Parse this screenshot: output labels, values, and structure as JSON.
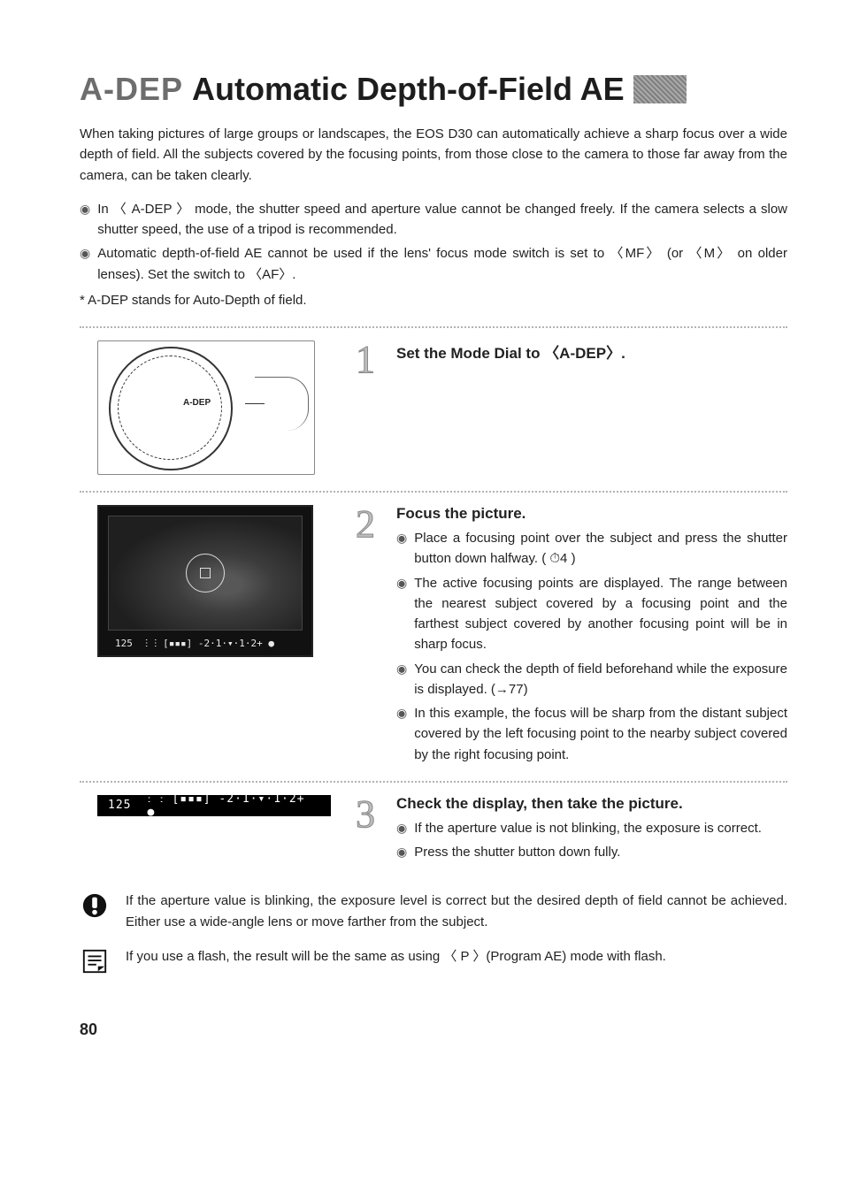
{
  "header": {
    "prefix": "A-DEP",
    "title": "Automatic Depth-of-Field AE"
  },
  "intro_main": "When taking pictures of large groups or landscapes, the EOS D30 can automatically achieve a sharp focus over a wide depth of field. All the subjects covered by the focusing points, from those close to the camera to those far away from the camera, can be taken clearly.",
  "intro_b1": "In 〈 A-DEP 〉 mode, the shutter speed and aperture value cannot be changed freely. If the camera selects a slow shutter speed, the use of a tripod is recommended.",
  "intro_b2": "Automatic depth-of-field AE cannot be used if the lens' focus mode switch is set to 〈MF〉 (or 〈M〉 on older lenses). Set the switch to 〈AF〉.",
  "intro_star": "* A-DEP stands for Auto-Depth of field.",
  "dial_label": "A-DEP",
  "vf_shutter": "125",
  "vf_readout": "ⵗ ⵗ [▪▪▪] -2·1·▾·1·2+ ●",
  "strip_shutter": "125",
  "strip_readout": "ⵗ ⵗ [▪▪▪] -2·1·▾·1·2+ ●",
  "steps": {
    "s1": {
      "num": "1",
      "title": "Set the Mode Dial to 〈A-DEP〉."
    },
    "s2": {
      "num": "2",
      "title": "Focus the picture.",
      "b1": "Place a focusing point over the subject and press the shutter button down halfway. ( ⏱4 )",
      "b2": "The active focusing points are displayed. The range between the nearest subject covered by a focusing point and the farthest subject covered by another focusing point will be in sharp focus.",
      "b3": "You can check the depth of field beforehand while the exposure is displayed. (→77)",
      "b4": "In this example, the focus will be sharp from the distant subject covered by the left focusing point to the nearby subject covered by the right focusing point."
    },
    "s3": {
      "num": "3",
      "title": "Check the display, then take the picture.",
      "b1": "If the aperture value is not blinking, the exposure is correct.",
      "b2": "Press the shutter button down fully."
    }
  },
  "notes": {
    "warn": "If the aperture value is blinking, the exposure level is correct but the desired depth of field cannot be achieved. Either use a wide-angle lens or move farther from the subject.",
    "info": "If you use a flash, the result will be the same as using 〈 P 〉(Program AE) mode with flash."
  },
  "page_number": "80"
}
